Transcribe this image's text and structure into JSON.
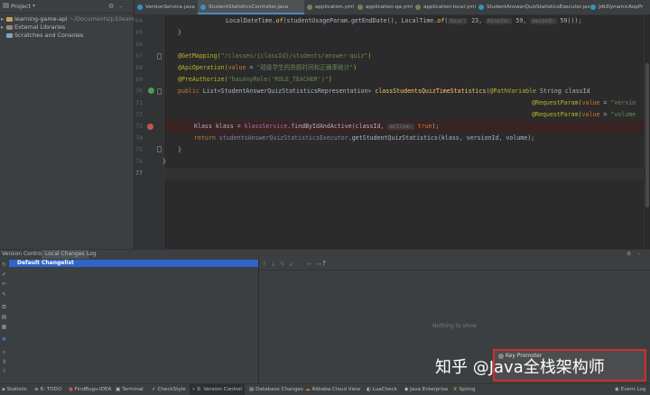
{
  "project_panel": {
    "title": "Project",
    "items": [
      {
        "label": "learning-game-api",
        "path": "~/Documents/p3/learning"
      },
      {
        "label": "External Libraries"
      },
      {
        "label": "Scratches and Consoles"
      }
    ]
  },
  "tabs": [
    {
      "label": "VersionService.java",
      "color": "#3592c4"
    },
    {
      "label": "StudentStatisticsController.java",
      "color": "#3592c4",
      "active": true
    },
    {
      "label": "application.yml",
      "color": "#6a8759"
    },
    {
      "label": "application-qa.yml",
      "color": "#6a8759"
    },
    {
      "label": "application-local.yml",
      "color": "#6a8759"
    },
    {
      "label": "StudentAnswerQuizStatisticsExecutor.java",
      "color": "#3592c4"
    },
    {
      "label": "JdkDynamicAopPr",
      "color": "#3592c4"
    }
  ],
  "line_numbers": [
    "64",
    "65",
    "66",
    "67",
    "68",
    "69",
    "70",
    "71",
    "72",
    "73",
    "74",
    "75",
    "76",
    "77"
  ],
  "code": {
    "l64a": "LocalDateTime.",
    "l64b": "of",
    "l64c": "(studentUsageParam.getEndDate(), LocalTime.",
    "l64d": "of",
    "l64e": "(",
    "l64h1": "hour:",
    "l64v1": " 23, ",
    "l64h2": "minute:",
    "l64v2": " 59, ",
    "l64h3": "second:",
    "l64v3": " 59)));",
    "l65": "}",
    "l67a": "@GetMapping(",
    "l67b": "\"/classes/{classId}/students/answer-quiz\"",
    "l67c": ")",
    "l68a": "@ApiOperation(",
    "l68b": "value",
    "l68c": " = ",
    "l68d": "\"班级学生的答题时间和正确率统计\"",
    "l68e": ")",
    "l69a": "@PreAuthorize(",
    "l69b": "\"hasAnyRole('ROLE_TEACHER')\"",
    "l69c": ")",
    "l70a": "public ",
    "l70b": "List<StudentAnswerQuizStatisticsRepresentation> ",
    "l70c": "classStudentsQuizTimeStatistics",
    "l70d": "(",
    "l70e": "@PathVariable",
    "l70f": " String classId",
    "l71a": "@RequestParam(",
    "l71b": "value",
    "l71c": " = ",
    "l71d": "\"versio",
    "l72a": "@RequestParam(",
    "l72b": "value",
    "l72c": " = ",
    "l72d": "\"volume",
    "l73a": "Klass klass = ",
    "l73b": "klassService",
    "l73c": ".findByIdAndActive(classId, ",
    "l73h": "active:",
    "l73d": " true",
    "l73e": ");",
    "l74a": "return ",
    "l74b": "studentsAnswerQuizStatisticsExecutor",
    "l74c": ".getStudentQuizStatistics(klass, versionId, volume);",
    "l75": "}",
    "l76": "}"
  },
  "version_control": {
    "tabs": [
      "Version Control:",
      "Local Changes",
      "Log"
    ],
    "changelist": "Default Changelist",
    "empty_text": "Nothing to show",
    "toolbar_help": "?"
  },
  "status_bar": [
    "Statistic",
    "6: TODO",
    "FindBugs-IDEA",
    "Terminal",
    "CheckStyle",
    "9: Version Control",
    "Database Changes",
    "Alibaba Cloud View",
    "LuaCheck",
    "Java Enterprise",
    "Spring",
    "Event Log"
  ],
  "key_promoter": {
    "title": "Key Promoter"
  },
  "watermark": "知乎 @Java全栈架构师",
  "colors": {
    "breakpoint": "#c75450",
    "accent": "#4a88c7",
    "highlight_border": "#d92b2b"
  }
}
